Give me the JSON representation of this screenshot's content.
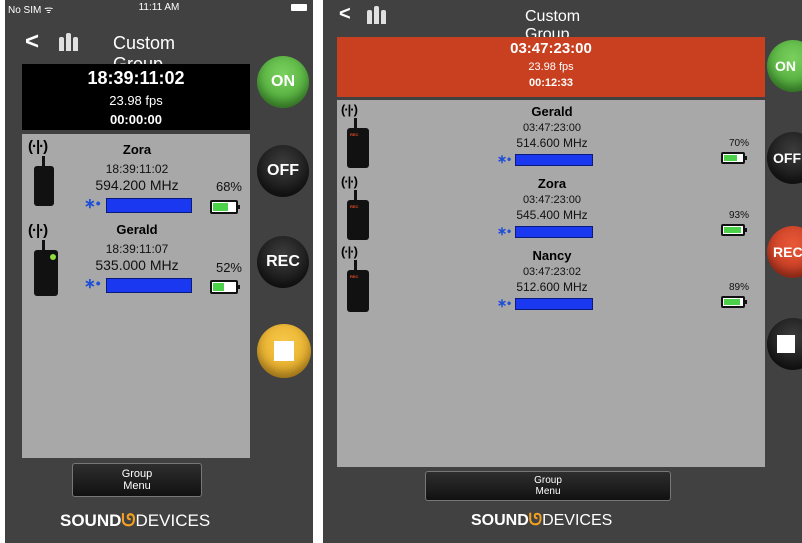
{
  "left": {
    "status_bar": {
      "carrier": "No SIM ᯤ",
      "time": "11:11 AM"
    },
    "nav": {
      "back_label": "<",
      "title": "Custom Group"
    },
    "timecode": {
      "main": "18:39:11:02",
      "fps": "23.98 fps",
      "elapsed": "00:00:00"
    },
    "devices": [
      {
        "name": "Zora",
        "timecode": "18:39:11:02",
        "frequency": "594.200 MHz",
        "battery_pct": "68%",
        "battery_level": 0.68
      },
      {
        "name": "Gerald",
        "timecode": "18:39:11:07",
        "frequency": "535.000 MHz",
        "battery_pct": "52%",
        "battery_level": 0.52
      }
    ],
    "buttons": {
      "on": "ON",
      "off": "OFF",
      "rec": "REC"
    },
    "group_menu": {
      "line1": "Group",
      "line2": "Menu"
    }
  },
  "right": {
    "nav": {
      "back_label": "<",
      "title": "Custom Group"
    },
    "timecode": {
      "main": "03:47:23:00",
      "fps": "23.98 fps",
      "elapsed": "00:12:33"
    },
    "devices": [
      {
        "name": "Gerald",
        "timecode": "03:47:23:00",
        "frequency": "514.600 MHz",
        "battery_pct": "70%",
        "battery_level": 0.7
      },
      {
        "name": "Zora",
        "timecode": "03:47:23:00",
        "frequency": "545.400 MHz",
        "battery_pct": "93%",
        "battery_level": 0.93
      },
      {
        "name": "Nancy",
        "timecode": "03:47:23:02",
        "frequency": "512.600 MHz",
        "battery_pct": "89%",
        "battery_level": 0.89
      }
    ],
    "buttons": {
      "on": "ON",
      "off": "OFF",
      "rec": "REC"
    },
    "group_menu": {
      "line1": "Group",
      "line2": "Menu"
    }
  },
  "logo": {
    "sound": "SOUND",
    "devices": "DEVICES"
  },
  "icons": {
    "bluetooth": "bluetooth-icon",
    "transmitter": "transmitter-icon",
    "microphones": "microphones-icon",
    "stop": "stop-icon",
    "battery": "battery-icon"
  },
  "colors": {
    "background": "#414141",
    "device_panel": "#a8a8a8",
    "rec_banner": "#c8401f",
    "on_green": "#4caf36",
    "stop_yellow": "#eab22c",
    "signal_blue": "#1a38f0",
    "battery_green": "#4cd14a"
  }
}
